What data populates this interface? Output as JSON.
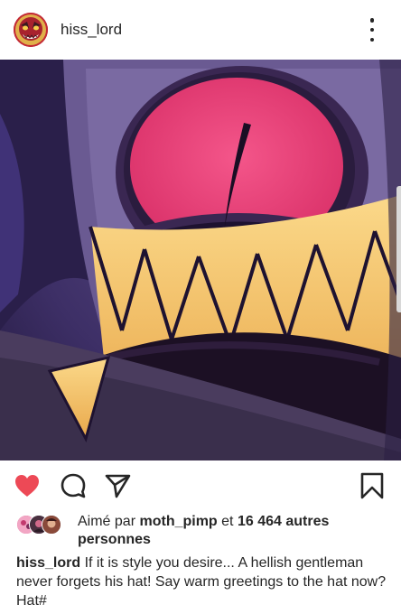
{
  "header": {
    "username": "hiss_lord",
    "avatar_icon": "demon-face-avatar-icon",
    "menu_icon": "more-vertical-icon"
  },
  "image": {
    "description_icon": "grinning-cartoon-face",
    "colors": {
      "background": "#3a2b58",
      "eye": "#ee4a7a",
      "teeth": "#f2c26a"
    }
  },
  "actions": {
    "like_icon": "heart-filled-icon",
    "comment_icon": "comment-icon",
    "share_icon": "paper-plane-icon",
    "save_icon": "bookmark-icon",
    "liked": true,
    "like_color": "#ed4956"
  },
  "likes": {
    "prefix": "Aimé par",
    "user": "moth_pimp",
    "connector": "et",
    "count_text": "16 464 autres personnes"
  },
  "caption": {
    "username": "hiss_lord",
    "text": "If it is style you desire... A hellish gentleman never forgets his hat! Say warm greetings to the hat now? Hat#"
  }
}
